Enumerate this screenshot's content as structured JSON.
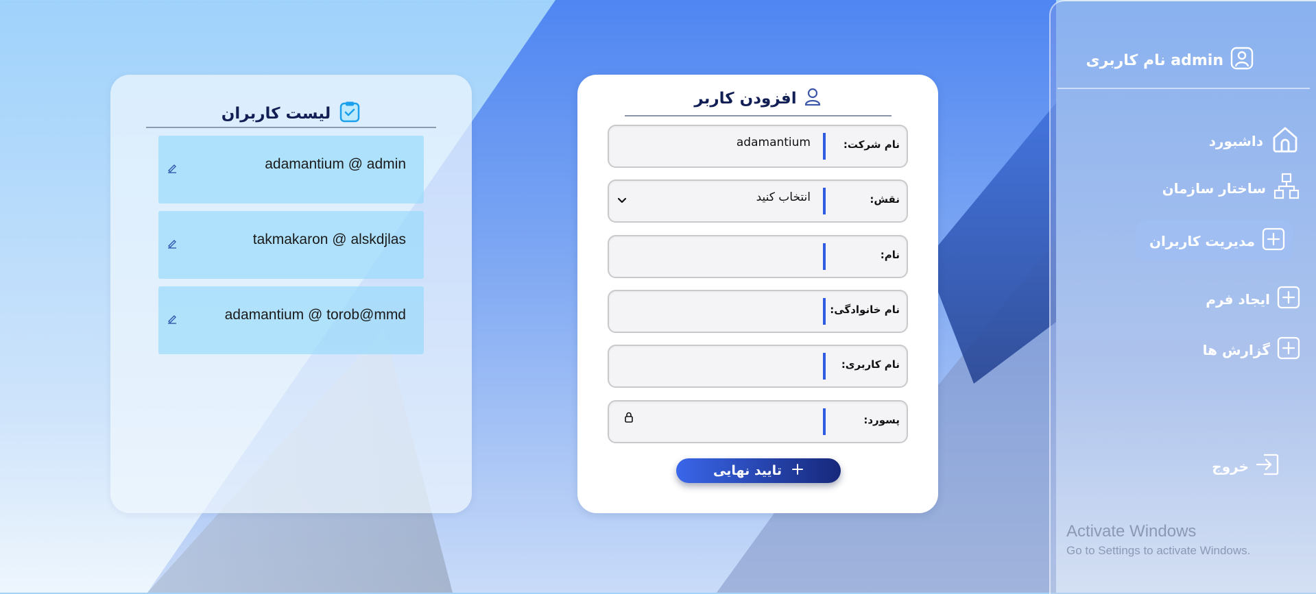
{
  "sidebar": {
    "title": "نام کاربری admin",
    "items": [
      {
        "label": "داشبورد",
        "icon": "home-icon"
      },
      {
        "label": "ساختار سازمان",
        "icon": "org-structure-icon"
      },
      {
        "label": "مدیریت کاربران",
        "icon": "plus-box-icon",
        "active": true
      },
      {
        "label": "ایجاد فرم",
        "icon": "plus-box-icon"
      },
      {
        "label": "گزارش ها",
        "icon": "plus-box-icon"
      }
    ],
    "logout_label": "خروج"
  },
  "form": {
    "title": "افزودن کاربر",
    "fields": [
      {
        "label": "نام شرکت:",
        "value": "adamantium"
      },
      {
        "label": "نقش:",
        "value": "انتخاب کنید"
      },
      {
        "label": "نام:",
        "value": ""
      },
      {
        "label": "نام خانوادگی:",
        "value": ""
      },
      {
        "label": "نام کاربری:",
        "value": ""
      },
      {
        "label": "پسورد:",
        "value": ""
      }
    ],
    "submit_label": "تایید نهایی"
  },
  "user_list": {
    "title": "لیست کاربران",
    "users": [
      "adamantium @ admin",
      "takmakaron @ alskdjlas",
      "adamantium @ torob@mmd"
    ]
  },
  "watermark": {
    "line1": "Activate Windows",
    "line2": "Go to Settings to activate Windows."
  },
  "colors": {
    "accent": "#2f5be0",
    "title_text": "#121f55",
    "card_bg": "#98dafb",
    "button_start": "#3a66ea",
    "button_end": "#16287a"
  }
}
